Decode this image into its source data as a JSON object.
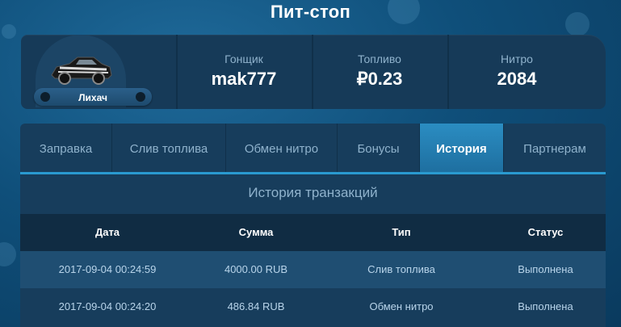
{
  "page": {
    "title": "Пит-стоп"
  },
  "profile": {
    "rank": "Лихач",
    "stats": [
      {
        "label": "Гонщик",
        "value": "mak777"
      },
      {
        "label": "Топливо",
        "value": "₽0.23"
      },
      {
        "label": "Нитро",
        "value": "2084"
      }
    ]
  },
  "tabs": [
    {
      "label": "Заправка"
    },
    {
      "label": "Слив топлива"
    },
    {
      "label": "Обмен нитро"
    },
    {
      "label": "Бонусы"
    },
    {
      "label": "История",
      "active": true
    },
    {
      "label": "Партнерам"
    }
  ],
  "history": {
    "title": "История транзакций",
    "columns": [
      "Дата",
      "Сумма",
      "Тип",
      "Статус"
    ],
    "rows": [
      [
        "2017-09-04 00:24:59",
        "4000.00 RUB",
        "Слив топлива",
        "Выполнена"
      ],
      [
        "2017-09-04 00:24:20",
        "486.84 RUB",
        "Обмен нитро",
        "Выполнена"
      ]
    ]
  }
}
